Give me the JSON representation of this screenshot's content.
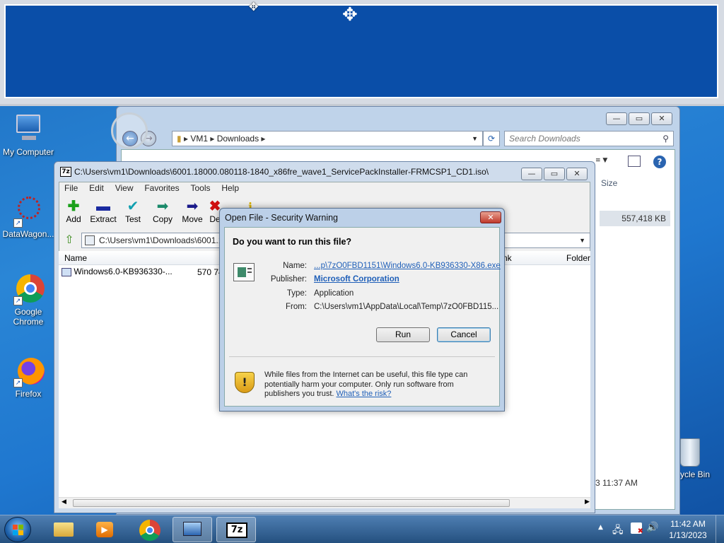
{
  "desktop": {
    "icons": [
      {
        "label": "My Computer"
      },
      {
        "label": "DataWagon..."
      },
      {
        "label": "Google Chrome"
      },
      {
        "label": "Firefox"
      },
      {
        "label": "ycle Bin"
      }
    ]
  },
  "explorer": {
    "breadcrumb": [
      "VM1",
      "Downloads"
    ],
    "search_placeholder": "Search Downloads",
    "col_size": "Size",
    "file_size": "557,418 KB",
    "date_fragment": "3 11:37 AM"
  },
  "sevenzip": {
    "title": "C:\\Users\\vm1\\Downloads\\6001.18000.080118-1840_x86fre_wave1_ServicePackInstaller-FRMCSP1_CD1.iso\\",
    "menu": [
      "File",
      "Edit",
      "View",
      "Favorites",
      "Tools",
      "Help"
    ],
    "toolbar": [
      "Add",
      "Extract",
      "Test",
      "Copy",
      "Move",
      "De"
    ],
    "path": "C:\\Users\\vm1\\Downloads\\6001.1",
    "columns": {
      "name": "Name",
      "link": "nk",
      "folder": "Folder"
    },
    "row": {
      "name": "Windows6.0-KB936330-...",
      "size": "570 74"
    }
  },
  "dialog": {
    "title": "Open File - Security Warning",
    "question": "Do you want to run this file?",
    "fields": [
      {
        "label": "Name:",
        "value": "...p\\7zO0FBD1151\\Windows6.0-KB936330-X86.exe"
      },
      {
        "label": "Publisher:",
        "value": "Microsoft Corporation"
      },
      {
        "label": "Type:",
        "value": "Application"
      },
      {
        "label": "From:",
        "value": "C:\\Users\\vm1\\AppData\\Local\\Temp\\7zO0FBD115..."
      }
    ],
    "run_label": "Run",
    "cancel_label": "Cancel",
    "warning_text": "While files from the Internet can be useful, this file type can potentially harm your computer. Only run software from publishers you trust.",
    "risk_link": "What's the risk?"
  },
  "taskbar": {
    "time": "11:42 AM",
    "date": "1/13/2023"
  },
  "colors": {
    "accent": "#1f5fb8",
    "desktop": "#1f77cf"
  }
}
